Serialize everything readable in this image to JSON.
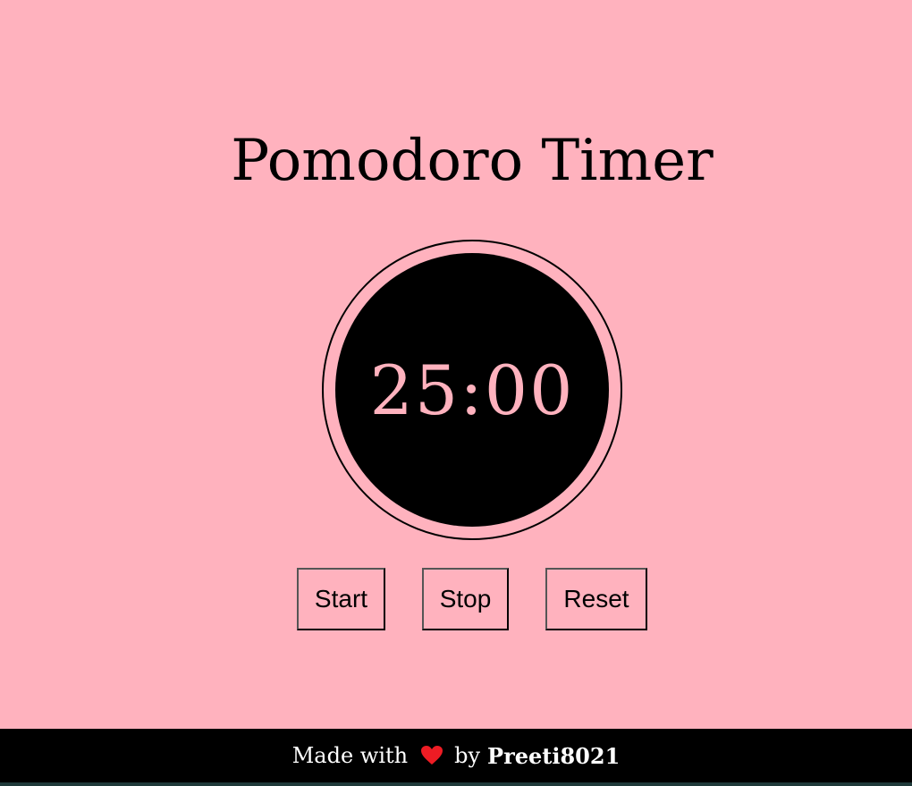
{
  "header": {
    "title": "Pomodoro Timer"
  },
  "timer": {
    "display": "25:00"
  },
  "controls": {
    "start_label": "Start",
    "stop_label": "Stop",
    "reset_label": "Reset"
  },
  "footer": {
    "made_with": "Made with",
    "by": "by",
    "author": "Preeti8021",
    "heart_icon": "heart-icon",
    "heart_color": "#ee1c24"
  },
  "colors": {
    "background": "#ffb2be",
    "timer_face": "#000000",
    "timer_text": "#ffb2be",
    "footer_bg": "#000000",
    "footer_text": "#ffffff"
  }
}
